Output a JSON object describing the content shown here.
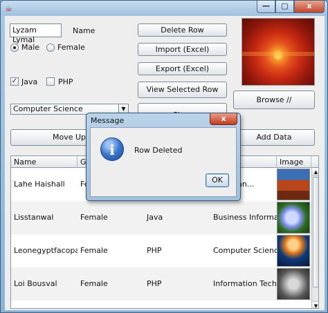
{
  "window": {
    "title": "",
    "minimize": "—",
    "maximize": "▢",
    "close": "x"
  },
  "form": {
    "name_value": "Lyzam Lymal",
    "name_label": "Name",
    "gender": {
      "male_label": "Male",
      "female_label": "Female",
      "selected": "Male"
    },
    "languages": {
      "java_label": "Java",
      "php_label": "PHP",
      "java_checked": true,
      "php_checked": false
    },
    "department_selected": "Computer Science"
  },
  "buttons": {
    "delete_row": "Delete Row",
    "import_excel": "Import (Excel)",
    "export_excel": "Export (Excel)",
    "view_selected": "View Selected Row",
    "browse": "Browse //",
    "clear": "Clear",
    "move_up": "Move Up",
    "add_data": "Add Data"
  },
  "table": {
    "columns": [
      "Name",
      "Ge",
      "",
      "",
      "Image"
    ],
    "rows": [
      {
        "name": "Lahe Haishall",
        "gender": "Fe",
        "language": "",
        "department": "on Techn...",
        "image": "canyon-thumbnail"
      },
      {
        "name": "Lisstanwal",
        "gender": "Female",
        "language": "Java",
        "department": "Business Informa...",
        "image": "hydrangea-thumbnail"
      },
      {
        "name": "Leonegyptfacopal",
        "gender": "Female",
        "language": "PHP",
        "department": "Computer Science",
        "image": "jellyfish-thumbnail"
      },
      {
        "name": "Loi Bousval",
        "gender": "Female",
        "language": "PHP",
        "department": "Information Techn...",
        "image": "koala-thumbnail"
      }
    ]
  },
  "dialog": {
    "title": "Message",
    "close": "x",
    "message": "Row Deleted",
    "ok": "OK",
    "icon": "info-icon"
  },
  "colors": {
    "window_frame": "#a9c9e4",
    "dialog_close": "#c23d22",
    "info_icon": "#3a74c9"
  }
}
